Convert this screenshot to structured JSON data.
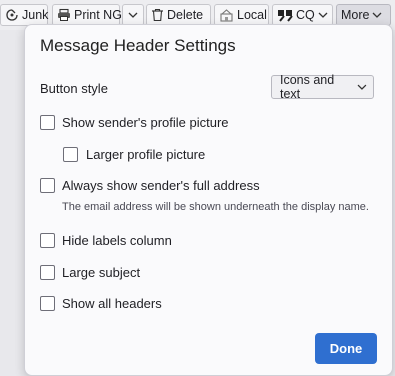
{
  "toolbar": {
    "junk": "Junk",
    "print": "Print NG",
    "delete": "Delete",
    "local": "Local",
    "cq": "CQ",
    "more": "More"
  },
  "dialog": {
    "title": "Message Header Settings",
    "button_style_label": "Button style",
    "button_style_value": "Icons and text",
    "options": {
      "profile_picture": "Show sender's profile picture",
      "larger_profile_picture": "Larger profile picture",
      "full_address": "Always show sender's full address",
      "full_address_desc": "The email address will be shown underneath the display name.",
      "hide_labels": "Hide labels column",
      "large_subject": "Large subject",
      "all_headers": "Show all headers"
    },
    "done_label": "Done"
  }
}
